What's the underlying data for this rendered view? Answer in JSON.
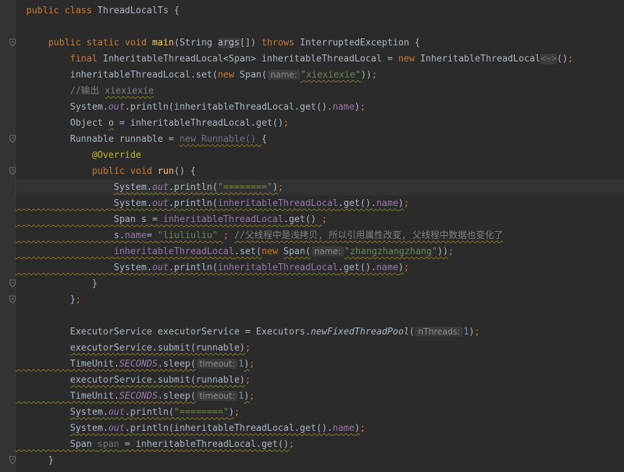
{
  "lines": [
    {
      "indent": "",
      "tokens": [
        {
          "t": "public ",
          "c": "kw"
        },
        {
          "t": "class ",
          "c": "kw"
        },
        {
          "t": "ThreadLocalTs {",
          "c": "plain"
        }
      ]
    },
    {
      "indent": "",
      "tokens": []
    },
    {
      "indent": "    ",
      "tokens": [
        {
          "t": "public ",
          "c": "kw"
        },
        {
          "t": "static ",
          "c": "kw"
        },
        {
          "t": "void ",
          "c": "kw"
        },
        {
          "t": "main",
          "c": "meth"
        },
        {
          "t": "(String ",
          "c": "plain"
        },
        {
          "t": "args",
          "c": "plain hl"
        },
        {
          "t": "[]) ",
          "c": "plain"
        },
        {
          "t": "throws ",
          "c": "kw"
        },
        {
          "t": "InterruptedException {",
          "c": "plain"
        }
      ]
    },
    {
      "indent": "        ",
      "tokens": [
        {
          "t": "final ",
          "c": "kw"
        },
        {
          "t": "InheritableThreadLocal<Span> inheritableThreadLocal = ",
          "c": "plain"
        },
        {
          "t": "new ",
          "c": "kw"
        },
        {
          "t": "InheritableThreadLocal",
          "c": "plain"
        },
        {
          "t": "<~>",
          "c": "dim hl"
        },
        {
          "t": "()",
          "c": "plain"
        },
        {
          "t": ";",
          "c": "kw"
        }
      ]
    },
    {
      "indent": "        ",
      "tokens": [
        {
          "t": "inheritableThreadLocal.set(",
          "c": "plain"
        },
        {
          "t": "new ",
          "c": "kw"
        },
        {
          "t": "Span(",
          "c": "plain"
        },
        {
          "t": "name:",
          "c": "hint"
        },
        {
          "t": "\"xiexiexie\"",
          "c": "str wavy"
        },
        {
          "t": "))",
          "c": "plain"
        },
        {
          "t": ";",
          "c": "kw"
        }
      ]
    },
    {
      "indent": "        ",
      "tokens": [
        {
          "t": "//输出 ",
          "c": "cmt"
        },
        {
          "t": "xiexiexie",
          "c": "cmt wavy"
        }
      ]
    },
    {
      "indent": "        ",
      "tokens": [
        {
          "t": "System.",
          "c": "plain"
        },
        {
          "t": "out",
          "c": "ital"
        },
        {
          "t": ".println(inheritableThreadLocal.get().",
          "c": "plain"
        },
        {
          "t": "name",
          "c": "fld"
        },
        {
          "t": ")",
          "c": "plain"
        },
        {
          "t": ";",
          "c": "kw"
        }
      ]
    },
    {
      "indent": "        ",
      "tokens": [
        {
          "t": "Object ",
          "c": "plain"
        },
        {
          "t": "o",
          "c": "plain wavy"
        },
        {
          "t": " = inheritableThreadLocal.get()",
          "c": "plain"
        },
        {
          "t": ";",
          "c": "kw"
        }
      ]
    },
    {
      "indent": "        ",
      "tokens": [
        {
          "t": "Runnable runnable = ",
          "c": "plain"
        },
        {
          "t": "new Runnable() ",
          "c": "dim wavy"
        },
        {
          "t": "{",
          "c": "plain"
        }
      ]
    },
    {
      "indent": "            ",
      "tokens": [
        {
          "t": "@Override",
          "c": "ann"
        }
      ]
    },
    {
      "indent": "            ",
      "tokens": [
        {
          "t": "public ",
          "c": "kw"
        },
        {
          "t": "void ",
          "c": "kw"
        },
        {
          "t": "run",
          "c": "meth"
        },
        {
          "t": "() {",
          "c": "plain"
        }
      ]
    },
    {
      "indent": "                ",
      "current": true,
      "tokens": [
        {
          "t": "System.",
          "c": "plain wavy"
        },
        {
          "t": "out",
          "c": "ital wavy"
        },
        {
          "t": ".println(",
          "c": "plain wavy"
        },
        {
          "t": "\"========\"",
          "c": "str wavy"
        },
        {
          "t": ")",
          "c": "plain wavy"
        },
        {
          "t": ";",
          "c": "kw"
        }
      ]
    },
    {
      "indent": "                ",
      "wavyIndent": true,
      "tokens": [
        {
          "t": "System.",
          "c": "plain wavy"
        },
        {
          "t": "out",
          "c": "ital wavy"
        },
        {
          "t": ".println(",
          "c": "plain wavy"
        },
        {
          "t": "inheritableThreadLocal",
          "c": "fld wavy"
        },
        {
          "t": ".get().",
          "c": "plain wavy"
        },
        {
          "t": "name",
          "c": "fld wavy"
        },
        {
          "t": ")",
          "c": "plain wavy"
        },
        {
          "t": ";",
          "c": "kw"
        }
      ]
    },
    {
      "indent": "                ",
      "wavyIndent": true,
      "tokens": [
        {
          "t": "Span s = ",
          "c": "plain wavy"
        },
        {
          "t": "inheritableThreadLocal",
          "c": "fld wavy"
        },
        {
          "t": ".get() ",
          "c": "plain wavy"
        },
        {
          "t": ";",
          "c": "kw"
        }
      ]
    },
    {
      "indent": "                ",
      "wavyIndent": true,
      "tokens": [
        {
          "t": "s.",
          "c": "plain wavy"
        },
        {
          "t": "name",
          "c": "fld wavy"
        },
        {
          "t": "= ",
          "c": "plain wavy"
        },
        {
          "t": "\"liuliuliu\" ",
          "c": "str wavy"
        },
        {
          "t": "; ",
          "c": "kw"
        },
        {
          "t": "//父线程中是浅拷贝, 所以引用属性改变, 父线程中数据也变化了",
          "c": "cmt wavy"
        }
      ]
    },
    {
      "indent": "                ",
      "wavyIndent": true,
      "tokens": [
        {
          "t": "inheritableThreadLocal",
          "c": "fld wavy"
        },
        {
          "t": ".set(",
          "c": "plain wavy"
        },
        {
          "t": "new ",
          "c": "kw"
        },
        {
          "t": "Span(",
          "c": "plain wavy"
        },
        {
          "t": "name:",
          "c": "hint"
        },
        {
          "t": "\"zhangzhangzhang\"",
          "c": "str wavy"
        },
        {
          "t": "))",
          "c": "plain wavy"
        },
        {
          "t": ";",
          "c": "kw"
        }
      ]
    },
    {
      "indent": "                ",
      "wavyIndent": true,
      "tokens": [
        {
          "t": "System.",
          "c": "plain wavy"
        },
        {
          "t": "out",
          "c": "ital wavy"
        },
        {
          "t": ".println(",
          "c": "plain wavy"
        },
        {
          "t": "inheritableThreadLocal",
          "c": "fld wavy"
        },
        {
          "t": ".get().",
          "c": "plain wavy"
        },
        {
          "t": "name",
          "c": "fld wavy"
        },
        {
          "t": ")",
          "c": "plain wavy"
        },
        {
          "t": ";",
          "c": "kw"
        }
      ]
    },
    {
      "indent": "            ",
      "tokens": [
        {
          "t": "}",
          "c": "plain"
        }
      ]
    },
    {
      "indent": "        ",
      "tokens": [
        {
          "t": "}",
          "c": "plain"
        },
        {
          "t": ";",
          "c": "kw"
        }
      ]
    },
    {
      "indent": "",
      "tokens": []
    },
    {
      "indent": "        ",
      "tokens": [
        {
          "t": "ExecutorService executorService = Executors.",
          "c": "plain"
        },
        {
          "t": "newFixedThreadPool",
          "c": "static-m"
        },
        {
          "t": "(",
          "c": "plain"
        },
        {
          "t": "nThreads:",
          "c": "hint"
        },
        {
          "t": "1",
          "c": "num"
        },
        {
          "t": ")",
          "c": "plain"
        },
        {
          "t": ";",
          "c": "kw"
        }
      ]
    },
    {
      "indent": "        ",
      "tokens": [
        {
          "t": "executorService.submit(runnable)",
          "c": "plain wavy"
        },
        {
          "t": ";",
          "c": "kw"
        }
      ]
    },
    {
      "indent": "        ",
      "wavyIndent": true,
      "tokens": [
        {
          "t": "TimeUnit.",
          "c": "plain wavy"
        },
        {
          "t": "SECONDS",
          "c": "ital wavy"
        },
        {
          "t": ".sleep(",
          "c": "plain wavy"
        },
        {
          "t": "timeout:",
          "c": "hint"
        },
        {
          "t": "1",
          "c": "num"
        },
        {
          "t": ")",
          "c": "plain wavy"
        },
        {
          "t": ";",
          "c": "kw"
        }
      ]
    },
    {
      "indent": "        ",
      "tokens": [
        {
          "t": "executorService.submit(runnable)",
          "c": "plain wavy"
        },
        {
          "t": ";",
          "c": "kw"
        }
      ]
    },
    {
      "indent": "        ",
      "wavyIndent": true,
      "tokens": [
        {
          "t": "TimeUnit.",
          "c": "plain wavy"
        },
        {
          "t": "SECONDS",
          "c": "ital wavy"
        },
        {
          "t": ".sleep(",
          "c": "plain wavy"
        },
        {
          "t": "timeout:",
          "c": "hint"
        },
        {
          "t": "1",
          "c": "num"
        },
        {
          "t": ")",
          "c": "plain wavy"
        },
        {
          "t": ";",
          "c": "kw"
        }
      ]
    },
    {
      "indent": "        ",
      "tokens": [
        {
          "t": "System.",
          "c": "plain wavy"
        },
        {
          "t": "out",
          "c": "ital wavy"
        },
        {
          "t": ".println(",
          "c": "plain wavy"
        },
        {
          "t": "\"========\"",
          "c": "str wavy"
        },
        {
          "t": ")",
          "c": "plain wavy"
        },
        {
          "t": ";",
          "c": "kw"
        }
      ]
    },
    {
      "indent": "        ",
      "tokens": [
        {
          "t": "System.",
          "c": "plain wavy"
        },
        {
          "t": "out",
          "c": "ital wavy"
        },
        {
          "t": ".println(inheritableThreadLocal.get().",
          "c": "plain wavy"
        },
        {
          "t": "name",
          "c": "fld wavy"
        },
        {
          "t": ")",
          "c": "plain wavy"
        },
        {
          "t": ";",
          "c": "kw"
        }
      ]
    },
    {
      "indent": "        ",
      "wavyIndent": true,
      "tokens": [
        {
          "t": "Span ",
          "c": "plain wavy"
        },
        {
          "t": "span",
          "c": "dim wavy"
        },
        {
          "t": " = inheritableThreadLocal.get()",
          "c": "plain wavy"
        },
        {
          "t": ";",
          "c": "kw"
        }
      ]
    },
    {
      "indent": "    ",
      "tokens": [
        {
          "t": "}",
          "c": "plain"
        }
      ]
    }
  ],
  "folds": [
    2,
    8,
    10,
    17,
    18,
    28
  ]
}
